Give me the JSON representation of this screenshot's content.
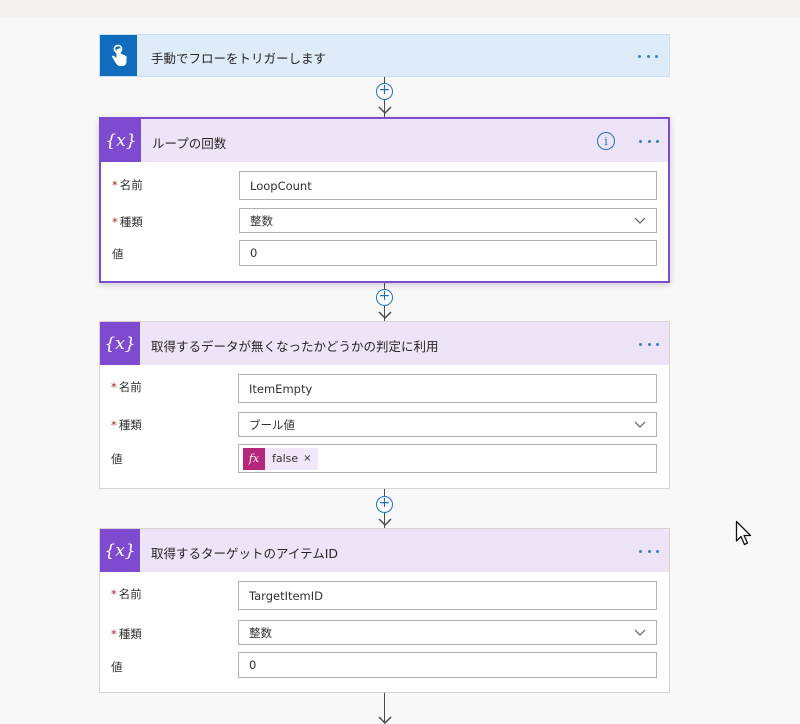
{
  "trigger": {
    "title": "手動でフローをトリガーします"
  },
  "cards": [
    {
      "title": "ループの回数",
      "fields": {
        "name_label": "名前",
        "name_value": "LoopCount",
        "type_label": "種類",
        "type_value": "整数",
        "value_label": "値",
        "value_value": "0"
      }
    },
    {
      "title": "取得するデータが無くなったかどうかの判定に利用",
      "fields": {
        "name_label": "名前",
        "name_value": "ItemEmpty",
        "type_label": "種類",
        "type_value": "ブール値",
        "value_label": "値",
        "value_token": "false",
        "token_icon": "fx",
        "token_remove": "×"
      }
    },
    {
      "title": "取得するターゲットのアイテムID",
      "fields": {
        "name_label": "名前",
        "name_value": "TargetItemID",
        "type_label": "種類",
        "type_value": "整数",
        "value_label": "値",
        "value_value": "0"
      }
    }
  ],
  "required_marker": "*",
  "variable_icon": "{x}",
  "info_icon": "i",
  "plus_glyph": "+",
  "colors": {
    "trigger": "#0f6cbd",
    "variable": "#7e4bd0",
    "link": "#1f6fc4",
    "expression": "#b4277a"
  }
}
